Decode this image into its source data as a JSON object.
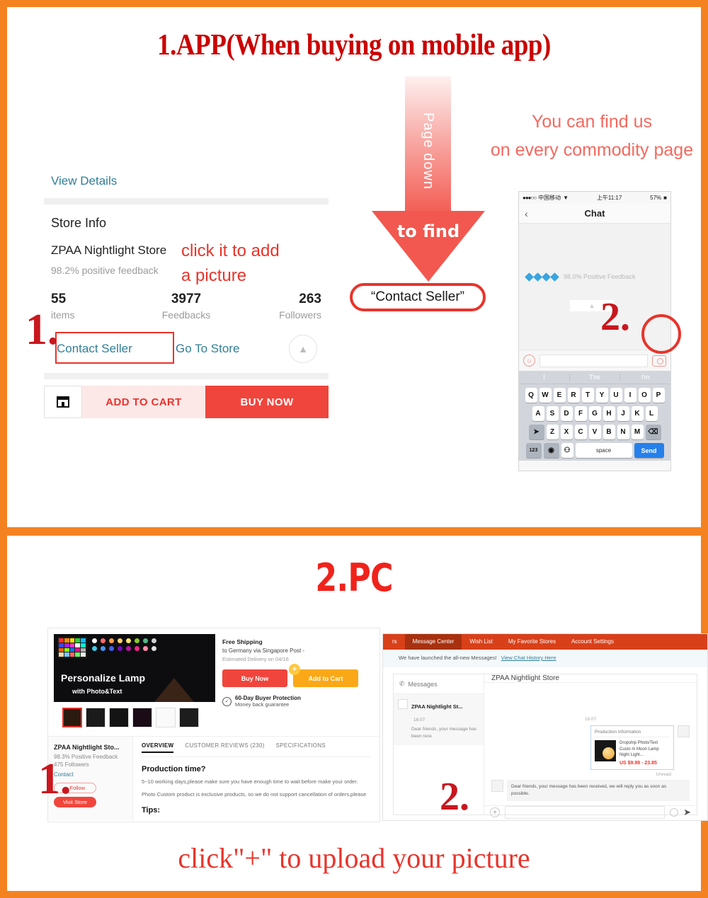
{
  "colors": {
    "frame_orange": "#F58220",
    "title_red": "#CC0000",
    "accent_red": "#E8342B",
    "pc_title_red": "#F0231B",
    "link_teal": "#2f7f97",
    "cart_orange": "#FAA818",
    "nav_red": "#D8401A"
  },
  "panel_app": {
    "title": "1.APP(When buying on mobile app)",
    "marker": "1.",
    "mobile": {
      "view_details": "View Details",
      "store_info_heading": "Store Info",
      "store_name": "ZPAA Nightlight Store",
      "store_feedback": "98.2% positive feedback",
      "stats": [
        {
          "value": "55",
          "label": "items"
        },
        {
          "value": "3977",
          "label": "Feedbacks"
        },
        {
          "value": "263",
          "label": "Followers"
        }
      ],
      "contact_seller": "Contact Seller",
      "go_to_store": "Go To Store",
      "collapse_icon": "chevron-up-icon",
      "store_icon": "store-icon",
      "add_to_cart": "ADD TO CART",
      "buy_now": "BUY NOW"
    },
    "annotation_note": "click it to add\na picture",
    "note_line1": "click it to add",
    "note_line2": "a picture",
    "page_down_arrow": {
      "shaft_text": "Page down",
      "head_text": "to find",
      "pill_text": "“Contact Seller”"
    },
    "find_us_line1": "You can find us",
    "find_us_line2": "on every commodity page",
    "phone": {
      "status": {
        "signal": "●●●○○",
        "carrier": "中国移动",
        "wifi": "wifi-icon",
        "time": "上午11:17",
        "battery": "57%"
      },
      "back_icon": "chevron-left-icon",
      "title": "Chat",
      "feedback": "98.0% Positive Feedback",
      "diamond_count": 4,
      "emoji_icon": "smiley-icon",
      "camera_icon": "camera-icon",
      "keyboard": {
        "suggestions": [
          "I",
          "The",
          "I'm"
        ],
        "row1": [
          "Q",
          "W",
          "E",
          "R",
          "T",
          "Y",
          "U",
          "I",
          "O",
          "P"
        ],
        "row2": [
          "A",
          "S",
          "D",
          "F",
          "G",
          "H",
          "J",
          "K",
          "L"
        ],
        "row3": [
          "Z",
          "X",
          "C",
          "V",
          "B",
          "N",
          "M"
        ],
        "shift_icon": "shift-icon",
        "backspace_icon": "backspace-icon",
        "numbers_key": "123",
        "globe_icon": "globe-icon",
        "mic_icon": "mic-icon",
        "space_key": "space",
        "send_key": "Send"
      }
    },
    "marker_2": "2."
  },
  "panel_pc": {
    "title": "2.PC",
    "marker_1": "1.",
    "marker_2": "2.",
    "caption": "click\"+\" to upload your picture",
    "product_page": {
      "hero_title": "Personalize Lamp",
      "hero_subtitle": "with Photo&Text",
      "shipping_title": "Free Shipping",
      "shipping_sub": "to Germany via Singapore Post -",
      "shipping_eta": "Estimated Delivery on 04/16",
      "buy_now": "Buy Now",
      "add_to_cart": "Add to Cart",
      "protection_title": "60-Day Buyer Protection",
      "protection_sub": "Money back guarantee",
      "store_name": "ZPAA Nightlight Sto...",
      "store_feedback": "98.3% Positive Feedback",
      "store_followers": "475 Followers",
      "contact": "Contact",
      "follow": "+ Follow",
      "visit_store": "Visit Store",
      "tabs": [
        "OVERVIEW",
        "CUSTOMER REVIEWS (230)",
        "SPECIFICATIONS"
      ],
      "heading": "Production time?",
      "body1": "5~10 working days,please make sure you have enough time to wait before make your order.",
      "body2": "Photo Custom product is exclusive products, so we do not support cancellation of orders,please",
      "tips": "Tips:"
    },
    "message_center": {
      "nav": [
        "rs",
        "Message Center",
        "Wish List",
        "My Favorite Stores",
        "Account Settings"
      ],
      "banner_text": "We have launched the all-new Messages!",
      "banner_link": "View Chat History Here",
      "list_header": "Messages",
      "thread_name": "ZPAA Nightlight St...",
      "thread_time": "16:07",
      "thread_preview": "Dear friends, your message has been rece",
      "chat_title": "ZPAA Nightlight Store",
      "chat_time": "16:07",
      "product_card_header": "Production Information",
      "product_card_title": "Dropship Photo/Text Custo m Moon Lamp Night Light...",
      "product_card_price": "US $9.98 - 23.85",
      "unread": "Unread",
      "reply_text": "Dear friends, your message has been received, we will reply you as soon as possible.",
      "plus_icon": "plus-icon",
      "emoji_icon": "smiley-icon",
      "send_icon": "send-arrow-icon"
    }
  }
}
